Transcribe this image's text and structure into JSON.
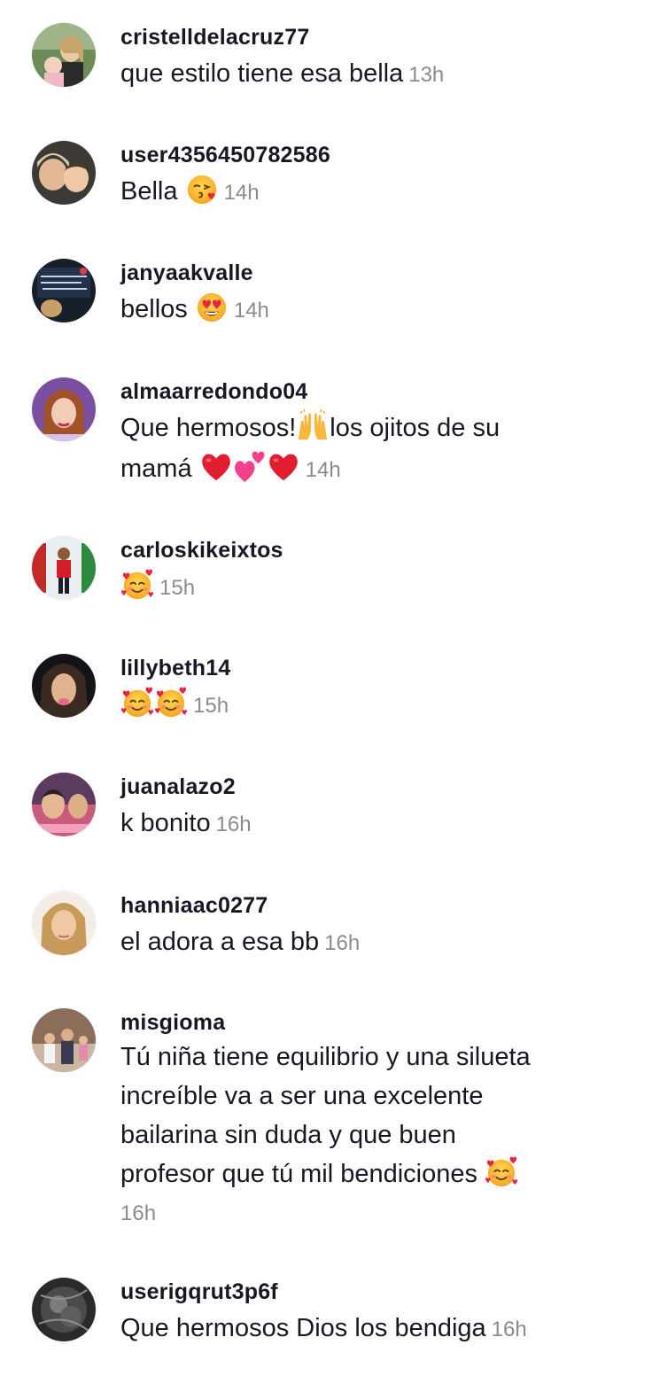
{
  "comments": [
    {
      "username": "cristelldelacruz77",
      "text": "que estilo tiene esa bella",
      "time": "13h"
    },
    {
      "username": "user4356450782586",
      "text": "Bella",
      "time": "14h",
      "emoji": "kissing-face-heart"
    },
    {
      "username": "janyaakvalle",
      "text": "bellos",
      "time": "14h",
      "emoji": "heart-eyes"
    },
    {
      "username": "almaarredondo04",
      "text_a": "Que hermosos!",
      "text_b": "los ojitos de su",
      "text_c": "mamá",
      "time": "14h",
      "emojis": [
        "raising-hands",
        "red-heart",
        "two-hearts",
        "red-heart"
      ]
    },
    {
      "username": "carloskikeixtos",
      "time": "15h",
      "emoji": "smiling-face-hearts"
    },
    {
      "username": "lillybeth14",
      "time": "15h",
      "emojis": [
        "smiling-face-hearts",
        "smiling-face-hearts"
      ]
    },
    {
      "username": "juanalazo2",
      "text": "k bonito",
      "time": "16h"
    },
    {
      "username": "hanniaac0277",
      "text": "el adora a esa bb",
      "time": "16h"
    },
    {
      "username": "misgioma",
      "lines": [
        "Tú niña tiene equilibrio y una silueta",
        "increíble va a ser una excelente",
        "bailarina sin duda y que buen",
        "profesor que tú mil bendiciones"
      ],
      "time": "16h",
      "emoji": "smiling-face-hearts"
    },
    {
      "username": "userigqrut3p6f",
      "text": "Que hermosos Dios los bendiga",
      "time": "16h"
    }
  ],
  "colors": {
    "username": "#161823",
    "text": "#161823",
    "timestamp": "#8a8b91",
    "background": "#ffffff"
  }
}
